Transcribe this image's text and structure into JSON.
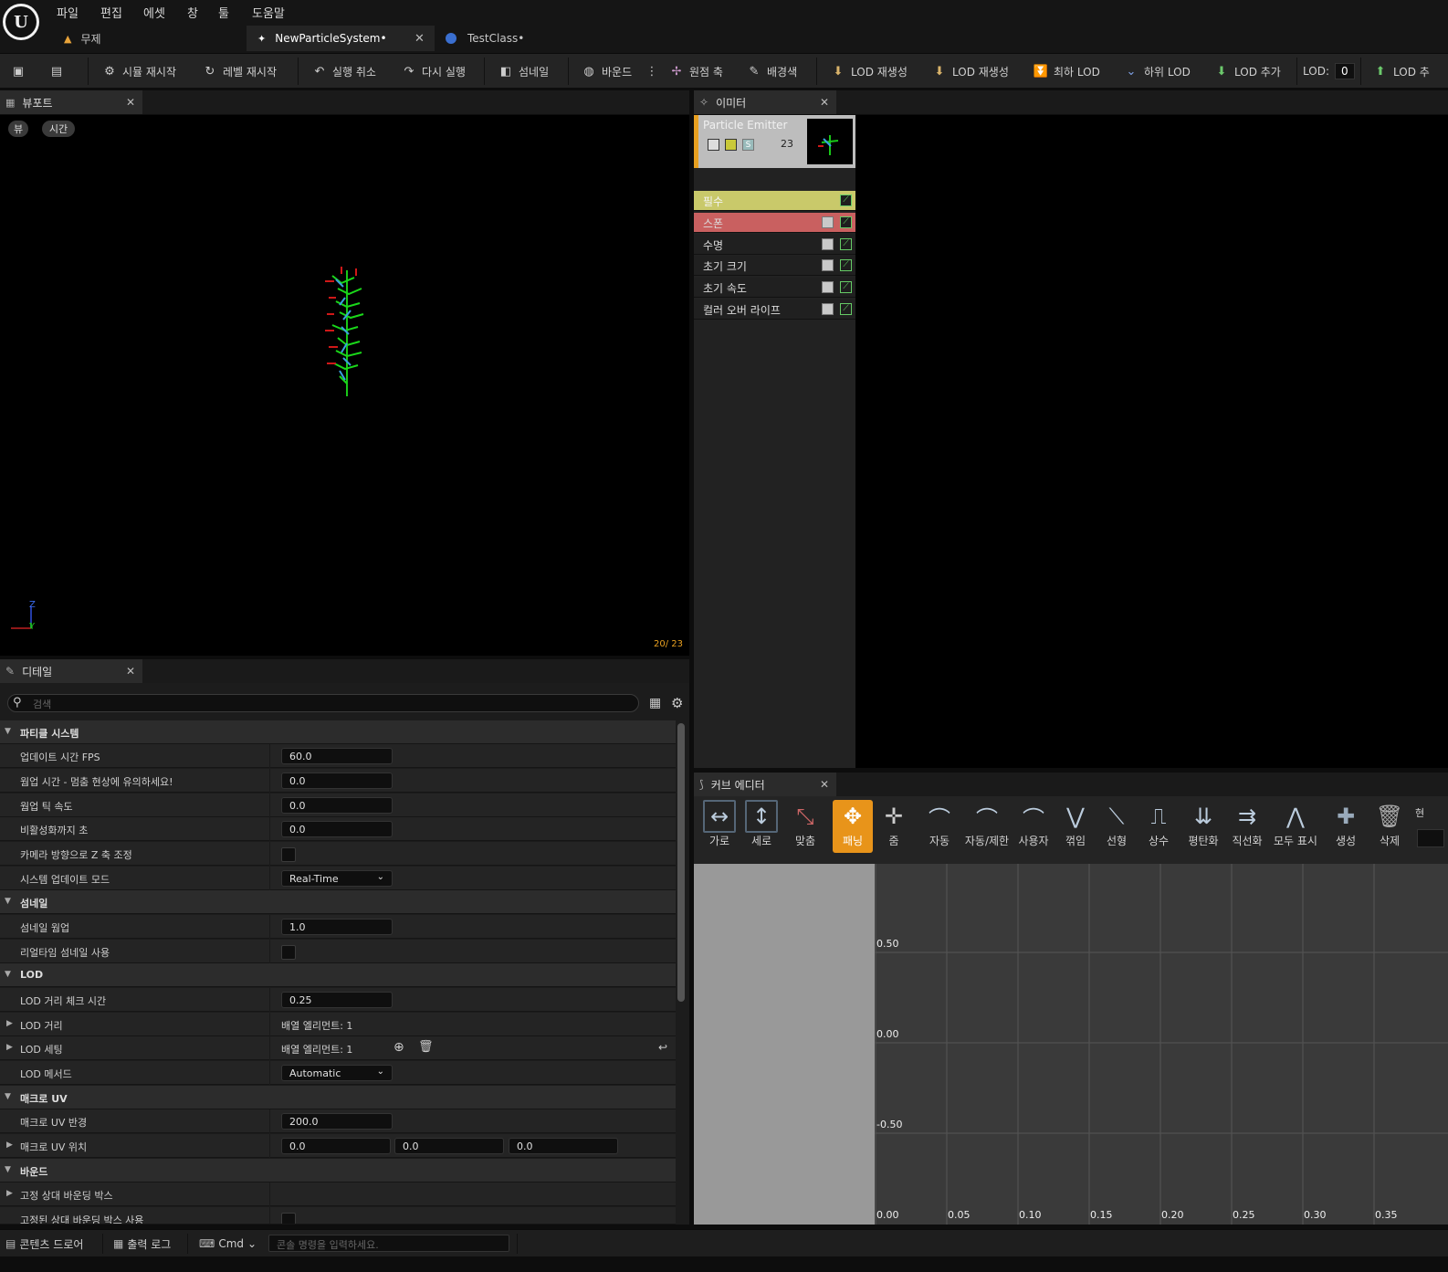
{
  "menu": [
    "파일",
    "편집",
    "에셋",
    "창",
    "툴",
    "도움말"
  ],
  "tabs": [
    {
      "label": "무제",
      "icon": "level-icon"
    },
    {
      "label": "NewParticleSystem•",
      "icon": "particle-icon"
    },
    {
      "label": "TestClass•",
      "icon": "blueprint-icon"
    }
  ],
  "toolbar": {
    "restart_sim": "시뮬 재시작",
    "restart_level": "레벨 재시작",
    "undo": "실행 취소",
    "redo": "다시 실행",
    "thumbnail": "섬네일",
    "bounds": "바운드",
    "origin_axis": "원점 축",
    "bg_color": "배경색",
    "regen_lod1": "LOD 재생성",
    "regen_lod2": "LOD 재생성",
    "lowest_lod": "최하 LOD",
    "lower_lod": "하위 LOD",
    "add_lod": "LOD 추가",
    "lod_label": "LOD:",
    "lod_value": "0",
    "add_lod2": "LOD 추"
  },
  "viewport": {
    "title": "뷰포트",
    "view_btn": "뷰",
    "time_btn": "시간",
    "counter": "20/ 23",
    "axis_z": "Z",
    "axis_y": "Y"
  },
  "emitters": {
    "title": "이미터",
    "emitter_name": "Particle Emitter",
    "emitter_count": "23",
    "modules": [
      {
        "name": "필수"
      },
      {
        "name": "스폰"
      },
      {
        "name": "수명"
      },
      {
        "name": "초기 크기"
      },
      {
        "name": "초기 속도"
      },
      {
        "name": "컬러 오버 라이프"
      }
    ]
  },
  "details": {
    "title": "디테일",
    "search_placeholder": "검색",
    "cat_particle": "파티클 시스템",
    "update_fps_label": "업데이트 시간 FPS",
    "update_fps": "60.0",
    "warmup_label": "웜업 시간 - 멈춤 현상에 유의하세요!",
    "warmup": "0.0",
    "warmup_tick_label": "웜업 틱 속도",
    "warmup_tick": "0.0",
    "deactivate_label": "비활성화까지 초",
    "deactivate": "0.0",
    "camera_z_label": "카메라 방향으로 Z 축 조정",
    "update_mode_label": "시스템 업데이트 모드",
    "update_mode": "Real-Time",
    "cat_thumbnail": "섬네일",
    "thumb_warmup_label": "섬네일 웜업",
    "thumb_warmup": "1.0",
    "realtime_thumb_label": "리얼타임 섬네일 사용",
    "cat_lod": "LOD",
    "lod_check_label": "LOD 거리 체크 시간",
    "lod_check": "0.25",
    "lod_distance_label": "LOD 거리",
    "lod_distance": "배열 엘리먼트: 1",
    "lod_settings_label": "LOD 세팅",
    "lod_settings": "배열 엘리먼트: 1",
    "lod_method_label": "LOD 메서드",
    "lod_method": "Automatic",
    "cat_macro": "매크로 UV",
    "macro_radius_label": "매크로 UV 반경",
    "macro_radius": "200.0",
    "macro_pos_label": "매크로 UV 위치",
    "macro_pos": [
      "0.0",
      "0.0",
      "0.0"
    ],
    "cat_bounds": "바운드",
    "fixed_bounds_label": "고정 상대 바운딩 박스",
    "use_fixed_bounds_label": "고정된 상대 바운딩 박스 사용"
  },
  "curve": {
    "title": "커브 에디터",
    "buttons": [
      "가로",
      "세로",
      "맞춤",
      "패닝",
      "줌",
      "자동",
      "자동/제한",
      "사용자",
      "꺾임",
      "선형",
      "상수",
      "평탄화",
      "직선화",
      "모두 표시",
      "생성",
      "삭제"
    ],
    "current_label": "현",
    "y_labels": [
      "0.50",
      "0.00",
      "-0.50"
    ],
    "x_labels": [
      "0.00",
      "0.05",
      "0.10",
      "0.15",
      "0.20",
      "0.25",
      "0.30",
      "0.35"
    ],
    "active_color": "#e8941a"
  },
  "bottom": {
    "content_drawer": "콘텐츠 드로어",
    "output_log": "출력 로그",
    "cmd": "Cmd",
    "console_placeholder": "콘솔 명령을 입력하세요."
  }
}
